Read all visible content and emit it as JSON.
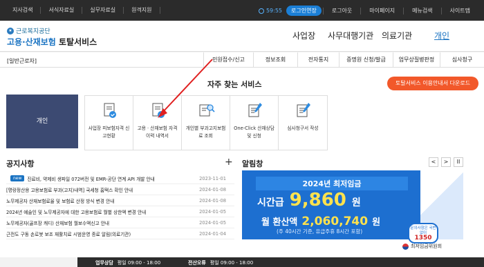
{
  "topbar": {
    "left_links": [
      "지사검색",
      "서식자료실",
      "실무자료실",
      "원격지원"
    ],
    "timer": "59:55",
    "login_extend": "로그인연장",
    "right_links": [
      "로그아웃",
      "마이페이지",
      "메뉴검색",
      "사이트맵"
    ]
  },
  "header": {
    "org_name": "근로복지공단",
    "service_prefix": "고용·산재보험",
    "service_suffix": "토탈서비스",
    "nav": [
      "사업장",
      "사무대행기관",
      "의료기관",
      "개인"
    ]
  },
  "subbar": {
    "user_label": "[일반근로자]",
    "menu": [
      "민원접수/신고",
      "정보조회",
      "전자통지",
      "증명원 신청/발급",
      "업무상질병판정",
      "심사청구"
    ]
  },
  "favorites": {
    "title": "자주 찾는 서비스",
    "guide_button": "토탈서비스 이용안내서 다운로드",
    "category": "개인",
    "tiles": [
      {
        "icon": "document-check-icon",
        "label": "사업장 피보험자격 신고현황"
      },
      {
        "icon": "document-check-icon",
        "label": "고용 · 산재보험 자격 이력 내역서"
      },
      {
        "icon": "document-search-icon",
        "label": "개인별 부과고지보험료 조회"
      },
      {
        "icon": "document-pen-icon",
        "label": "One-Click 산재상담 및 신청"
      },
      {
        "icon": "document-pen-icon",
        "label": "심사청구서 작성"
      }
    ]
  },
  "notice": {
    "title": "공지사항",
    "new_badge": "new",
    "items": [
      {
        "title": "진료비, 약제비 생파일 072버전 및 EMR-공단 연계 API 개발 안내",
        "date": "2023-11-01",
        "is_new": true
      },
      {
        "title": "[명랑정산용 고용보험료 부과(고지)내역] 국세청 홈택스 확인 안내",
        "date": "2024-01-08",
        "is_new": false
      },
      {
        "title": "노무제공자 산재보험료율 및 보험료 산정 방식 변경 안내",
        "date": "2024-01-08",
        "is_new": false
      },
      {
        "title": "2024년 예술인 및 노무제공자에 대한 고용보험료 월별 상한액 변경 안내",
        "date": "2024-01-05",
        "is_new": false
      },
      {
        "title": "노무제공자(골프장 캐디) 산재보험 월보수액신고 안내",
        "date": "2024-01-05",
        "is_new": false
      },
      {
        "title": "근전도 구동 손로봇 보조 재활치료 시범운영 종료 알림(의료기관)",
        "date": "2024-01-04",
        "is_new": false
      }
    ]
  },
  "alarm": {
    "title": "알림창",
    "prev": "<",
    "next": ">",
    "pause": "II",
    "banner": {
      "title": "2024년 최저임금",
      "hourly_label": "시간급",
      "hourly_value": "9,860",
      "unit": "원",
      "monthly_label": "월 환산액",
      "monthly_value": "2,060,740",
      "monthly_note": "(주 40시간 기준, 유급주휴 8시간 포함)",
      "ribbon_text": "문의사항은 국번 없이",
      "ribbon_number": "1350",
      "footer_org": "최저임금위원회"
    }
  },
  "footer": {
    "hours_label1": "업무상담",
    "hours_value1": "평일 09:00 - 18:00",
    "hours_label2": "전산오류",
    "hours_value2": "평일 09:00 - 18:00"
  },
  "colors": {
    "accent": "#1a73c2",
    "orange": "#f2582a",
    "navy": "#3c4a72",
    "topbar": "#2b2b2b"
  }
}
